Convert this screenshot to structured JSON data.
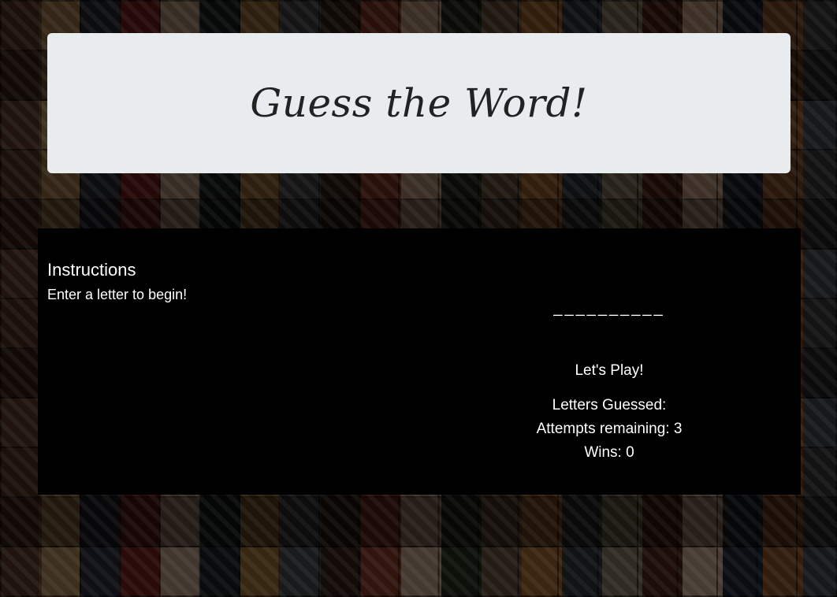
{
  "title": "Guess the Word!",
  "instructions": {
    "heading": "Instructions",
    "text": "Enter a letter to begin!"
  },
  "game": {
    "word_blanks": "__________",
    "status": "Let's Play!",
    "letters_guessed_label": "Letters Guessed:",
    "attempts_label": "Attempts remaining: 3",
    "wins_label": "Wins: 0"
  },
  "colors": {
    "title_card_bg": "#e9ecef",
    "panel_bg": "#000000",
    "text_light": "#ffffff"
  }
}
